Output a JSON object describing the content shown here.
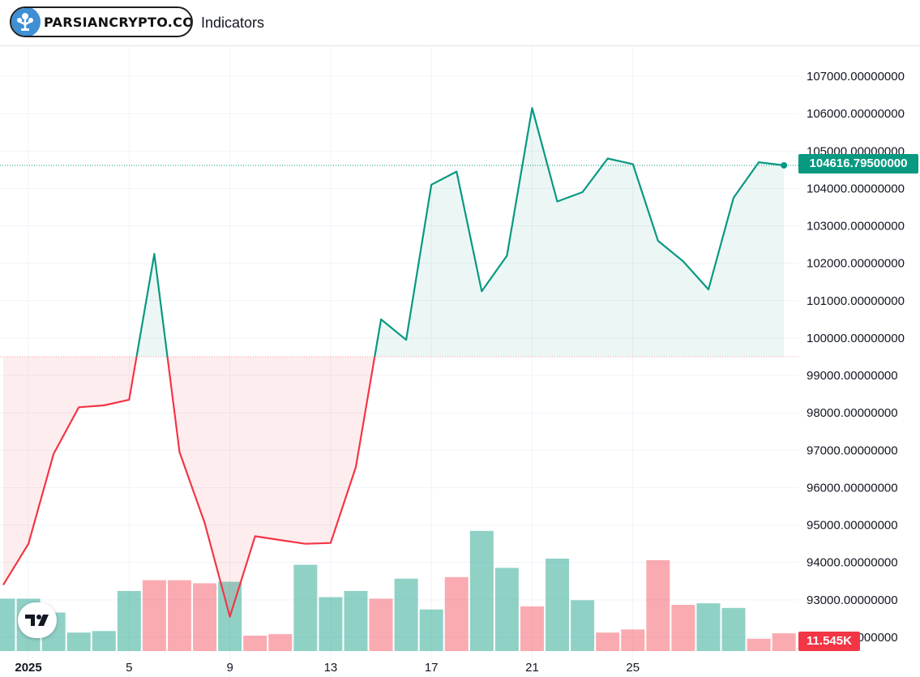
{
  "toolbar": {
    "logo_text": "PARSIANCRYPTO.COM",
    "indicators_label": "Indicators"
  },
  "colors": {
    "up": "#089981",
    "down": "#f23645",
    "up_fill": "rgba(8,153,129,0.08)",
    "down_fill": "rgba(242,54,69,0.09)",
    "vol_up": "rgba(8,153,129,0.45)",
    "vol_down": "rgba(242,54,69,0.42)",
    "grid": "#f0f3fa"
  },
  "icons": [
    "parsiancrypto-logo-icon",
    "tradingview-logo-icon"
  ],
  "chart_data": {
    "type": "area",
    "baseline": 99500,
    "ylim": [
      91250,
      107800
    ],
    "y_ticks": [
      92000,
      93000,
      94000,
      95000,
      96000,
      97000,
      98000,
      99000,
      100000,
      101000,
      102000,
      103000,
      104000,
      105000,
      106000,
      107000
    ],
    "y_tick_labels": [
      "92000.00000000",
      "93000.00000000",
      "94000.00000000",
      "95000.00000000",
      "96000.00000000",
      "97000.00000000",
      "98000.00000000",
      "99000.00000000",
      "100000.00000000",
      "101000.00000000",
      "102000.00000000",
      "103000.00000000",
      "104000.00000000",
      "105000.00000000",
      "106000.00000000",
      "107000.00000000"
    ],
    "x_day_range": [
      -0.02,
      30.9
    ],
    "x_ticks": [
      {
        "day": 1,
        "label": "2025"
      },
      {
        "day": 5,
        "label": "5"
      },
      {
        "day": 9,
        "label": "9"
      },
      {
        "day": 13,
        "label": "13"
      },
      {
        "day": 17,
        "label": "17"
      },
      {
        "day": 21,
        "label": "21"
      },
      {
        "day": 25,
        "label": "25"
      }
    ],
    "grid": true,
    "last_price": 104616.795,
    "last_price_label": "104616.79500000",
    "last_volume_label": "11.545K",
    "series": [
      {
        "days": [
          0,
          1,
          2,
          3,
          4,
          5,
          6,
          7,
          8,
          9,
          10,
          11,
          12,
          13,
          14,
          15,
          16,
          17,
          18,
          19,
          20,
          21,
          22,
          23,
          24,
          25,
          26,
          27,
          28,
          29,
          30,
          31
        ],
        "close": [
          93400,
          94500,
          96900,
          98150,
          98200,
          98350,
          102250,
          96950,
          95050,
          92550,
          94700,
          94600,
          94500,
          94520,
          96550,
          100500,
          99950,
          104100,
          104450,
          101250,
          102200,
          106150,
          103650,
          103900,
          104800,
          104650,
          102600,
          102050,
          101300,
          103750,
          104700,
          104617
        ]
      }
    ],
    "volume": {
      "days": [
        0,
        1,
        2,
        3,
        4,
        5,
        6,
        7,
        8,
        9,
        10,
        11,
        12,
        13,
        14,
        15,
        16,
        17,
        18,
        19,
        20,
        21,
        22,
        23,
        24,
        25,
        26,
        27,
        28,
        29,
        30,
        31
      ],
      "values": [
        34,
        34,
        25,
        12,
        13,
        39,
        46,
        46,
        44,
        45,
        10,
        11,
        56,
        35,
        39,
        34,
        47,
        27,
        48,
        78,
        54,
        29,
        60,
        33,
        12,
        14,
        59,
        30,
        31,
        28,
        8,
        11.545
      ],
      "up": [
        true,
        true,
        true,
        true,
        true,
        true,
        false,
        false,
        false,
        true,
        false,
        false,
        true,
        true,
        true,
        false,
        true,
        true,
        false,
        true,
        true,
        false,
        true,
        true,
        false,
        false,
        false,
        false,
        true,
        true,
        false,
        false
      ],
      "max_scale": 100
    }
  }
}
